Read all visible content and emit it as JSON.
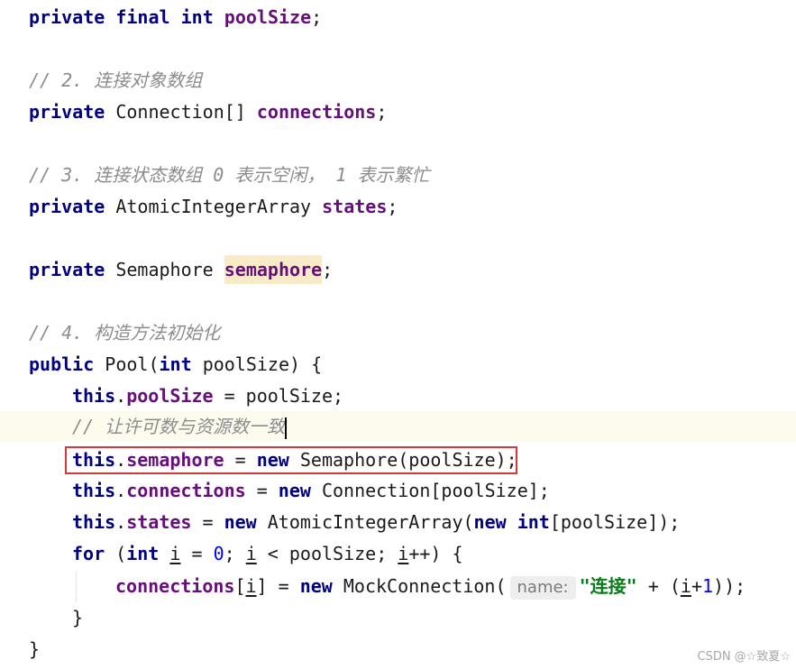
{
  "code": {
    "line1": {
      "private": "private",
      "final": "final",
      "int": "int",
      "field": "poolSize",
      "semi": ";"
    },
    "comment2": "// 2. 连接对象数组",
    "line2": {
      "private": "private",
      "type": "Connection[]",
      "field": "connections",
      "semi": ";"
    },
    "comment3": "// 3. 连接状态数组 0 表示空闲， 1 表示繁忙",
    "line3": {
      "private": "private",
      "type": "AtomicIntegerArray",
      "field": "states",
      "semi": ";"
    },
    "line4": {
      "private": "private",
      "type": "Semaphore",
      "field": "semaphore",
      "semi": ";"
    },
    "comment4": "// 4. 构造方法初始化",
    "ctor": {
      "public": "public",
      "name": "Pool(",
      "int": "int",
      "param": "poolSize) {"
    },
    "assign1": {
      "this": "this",
      "dot": ".",
      "field": "poolSize",
      "rest": " = poolSize;"
    },
    "comment5": "// 让许可数与资源数一致",
    "assign2": {
      "this": "this",
      "dot": ".",
      "field": "semaphore",
      "eq": " = ",
      "new": "new",
      "rest": " Semaphore(poolSize);"
    },
    "assign3": {
      "this": "this",
      "dot": ".",
      "field": "connections",
      "eq": " = ",
      "new": "new",
      "rest": " Connection[poolSize];"
    },
    "assign4": {
      "this": "this",
      "dot": ".",
      "field": "states",
      "eq": " = ",
      "new": "new",
      "mid": " AtomicIntegerArray(",
      "new2": "new",
      "int": "int",
      "end": "[poolSize]);"
    },
    "for_line": {
      "for": "for",
      "open": " (",
      "int": "int",
      "i1": "i",
      "eq": " = ",
      "zero": "0",
      "semi1": "; ",
      "i2": "i",
      "cond": " < poolSize; ",
      "i3": "i",
      "inc": "++) {"
    },
    "body_line": {
      "field": "connections",
      "open": "[",
      "i": "i",
      "close": "]",
      "eq": " = ",
      "new": "new",
      "call": " MockConnection(",
      "hint": "name:",
      "str": "\"连接\"",
      "plus": " + (",
      "plus2": "+",
      "one": "1",
      "end": "));"
    },
    "close_for": "}",
    "close_ctor": "}"
  },
  "watermark": "CSDN @☆致夏☆",
  "colors": {
    "keyword": "#000080",
    "field": "#660e7a",
    "number": "#0000ff",
    "string": "#067d17",
    "comment": "#8c8c8c",
    "highlight_box": "#d9383a"
  }
}
